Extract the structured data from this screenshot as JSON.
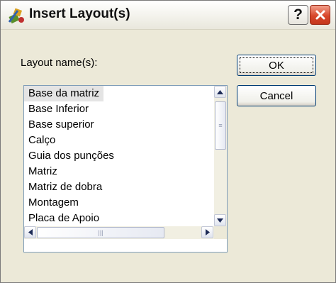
{
  "window": {
    "title": "Insert Layout(s)",
    "help_label": "?"
  },
  "dialog": {
    "label": "Layout name(s):",
    "ok_label": "OK",
    "cancel_label": "Cancel"
  },
  "list": {
    "selected_index": 0,
    "items": [
      "Base da matriz",
      "Base Inferior",
      "Base superior",
      "Calço",
      "Guia dos punções",
      "Matriz",
      "Matriz de  dobra",
      "Montagem",
      "Placa de Apoio"
    ]
  },
  "colors": {
    "dialog_bg": "#ece9d8",
    "list_border": "#7f9db9",
    "selection_bg": "#e4e4e4",
    "close_button": "#d8472b",
    "button_border": "#003c74"
  }
}
